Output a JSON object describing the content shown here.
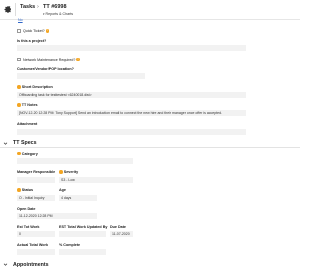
{
  "header": {
    "tasks_label": "Tasks",
    "separator": "›",
    "task_title": "TT #6998",
    "sub_caret": "▾",
    "sub_label": "Reports & Charts"
  },
  "form": {
    "top_link": "No",
    "quick_ticket_label": "Quick Ticket?",
    "is_project_label": "Is this a project?",
    "network_maint_label": "Network Maintenance Required?",
    "customer_vendor_label": "Customer/Vendor/POP location?",
    "short_description_label": "Short Description",
    "short_description_value": "Offboarding task for testtestest <6240018.dist>",
    "tt_notes_label": "TT Notes",
    "tt_notes_value": "[NOV-12-20 12:28 PM: Tony Support] Send an introduction email to connect the new hire and their manager once offer is accepted.",
    "attachment_label": "Attachment"
  },
  "tt_specs": {
    "title": "TT Specs",
    "category_label": "Category",
    "manager_responsible_label": "Manager Responsible",
    "severity_label": "Severity",
    "severity_value": "S3 - Low",
    "status_label": "Status",
    "status_value": "O - Initial Inquiry",
    "age_label": "Age",
    "age_value": "4 days",
    "open_date_label": "Open Date",
    "open_date_value": "11-12-2020 12:28 PM",
    "est_tot_work_label": "Est Tot Work",
    "est_tot_work_value": "0",
    "est_tot_work_updated_label": "EST Total Work Updated By",
    "due_date_label": "Due Date",
    "due_date_value": "11-07-2020",
    "actual_total_work_label": "Actual Total Work",
    "percent_complete_label": "% Complete"
  },
  "appointments": {
    "title": "Appointments"
  },
  "colors": {
    "accent_orange": "#f3a623",
    "link_blue": "#2f66c8",
    "field_bg": "#f2f2f2"
  },
  "icons": [
    "gear-icon",
    "caret-down-icon",
    "info-icon",
    "required-icon",
    "chevron-down-icon"
  ]
}
